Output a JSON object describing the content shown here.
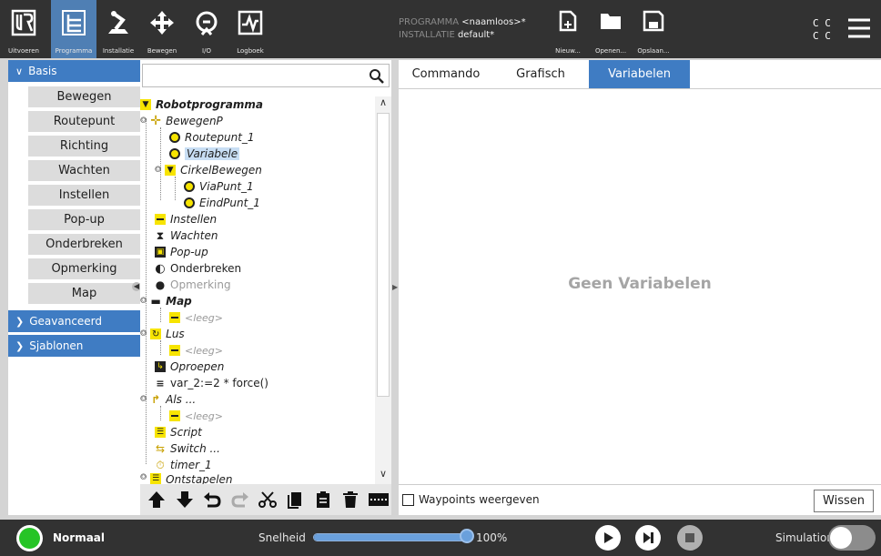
{
  "topbar": {
    "buttons": [
      {
        "label": "Uitvoeren",
        "icon": "ur-logo-icon"
      },
      {
        "label": "Programma",
        "icon": "program-icon"
      },
      {
        "label": "Installatie",
        "icon": "robot-arm-icon"
      },
      {
        "label": "Bewegen",
        "icon": "move-icon"
      },
      {
        "label": "I/O",
        "icon": "io-icon"
      },
      {
        "label": "Logboek",
        "icon": "log-icon"
      }
    ],
    "program_key": "PROGRAMMA",
    "program_value": "<naamloos>*",
    "install_key": "INSTALLATIE",
    "install_value": "default*",
    "file_buttons": [
      {
        "label": "Nieuw...",
        "icon": "new-file-icon"
      },
      {
        "label": "Openen...",
        "icon": "folder-icon"
      },
      {
        "label": "Opslaan...",
        "icon": "save-icon"
      }
    ],
    "cc": [
      "C C",
      "C C"
    ],
    "menu_icon": "hamburger-menu-icon"
  },
  "sidebar": {
    "basis": "Basis",
    "items": [
      "Bewegen",
      "Routepunt",
      "Richting",
      "Wachten",
      "Instellen",
      "Pop-up",
      "Onderbreken",
      "Opmerking",
      "Map"
    ],
    "advanced": "Geavanceerd",
    "templates": "Sjablonen"
  },
  "tree": {
    "root": "Robotprogramma",
    "nodes": [
      {
        "text": "BewegenP",
        "icon": "move-icon"
      },
      {
        "text": "Routepunt_1",
        "icon": "waypoint-icon"
      },
      {
        "text": "Variabele",
        "icon": "waypoint-icon"
      },
      {
        "text": "CirkelBewegen",
        "icon": "triangle-icon"
      },
      {
        "text": "ViaPunt_1",
        "icon": "waypoint-icon"
      },
      {
        "text": "EindPunt_1",
        "icon": "waypoint-icon"
      },
      {
        "text": "Instellen",
        "icon": "set-icon"
      },
      {
        "text": "Wachten",
        "icon": "hourglass-icon"
      },
      {
        "text": "Pop-up",
        "icon": "popup-icon"
      },
      {
        "text": "Onderbreken",
        "icon": "halt-icon"
      },
      {
        "text": "Opmerking",
        "icon": "comment-icon"
      },
      {
        "text": "Map",
        "icon": "folder-icon"
      },
      {
        "text": "<leeg>",
        "icon": "empty-icon"
      },
      {
        "text": "Lus",
        "icon": "loop-icon"
      },
      {
        "text": "<leeg>",
        "icon": "empty-icon"
      },
      {
        "text": "Oproepen",
        "icon": "call-icon"
      },
      {
        "text": "var_2:=2 * force()",
        "icon": "assignment-icon"
      },
      {
        "text": "Als ...",
        "icon": "if-icon"
      },
      {
        "text": "<leeg>",
        "icon": "empty-icon"
      },
      {
        "text": "Script",
        "icon": "script-icon"
      },
      {
        "text": "Switch ...",
        "icon": "switch-icon"
      },
      {
        "text": "timer_1",
        "icon": "timer-icon"
      },
      {
        "text": "Ontstapelen",
        "icon": "unstack-icon"
      }
    ]
  },
  "right": {
    "tabs": [
      "Commando",
      "Grafisch",
      "Variabelen"
    ],
    "active_tab": "Variabelen",
    "empty_text": "Geen Variabelen",
    "checkbox_label": "Waypoints weergeven",
    "clear_button": "Wissen"
  },
  "bottom": {
    "status": "Normaal",
    "speed_label": "Snelheid",
    "speed_value": "100%",
    "speed_fraction": 1.0,
    "mode_label": "Simulation"
  },
  "colors": {
    "accent": "#3f7cc3",
    "topbar": "#323232",
    "status_green": "#26c426"
  }
}
